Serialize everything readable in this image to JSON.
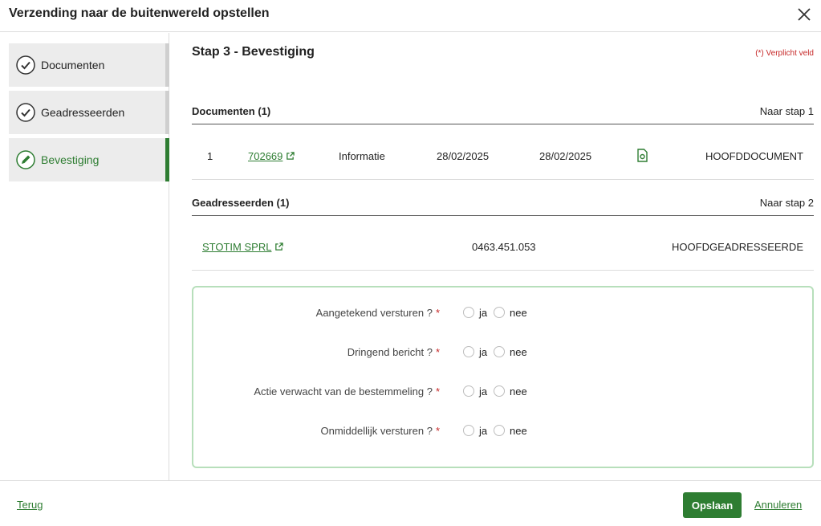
{
  "dialog": {
    "title": "Verzending naar de buitenwereld opstellen",
    "close_icon": "close-icon"
  },
  "sidebar": {
    "steps": [
      {
        "label": "Documenten",
        "state": "done",
        "icon": "check-circle-icon"
      },
      {
        "label": "Geadresseerden",
        "state": "done",
        "icon": "check-circle-icon"
      },
      {
        "label": "Bevestiging",
        "state": "active",
        "icon": "pencil-circle-icon"
      }
    ]
  },
  "main": {
    "step_title": "Stap 3 - Bevestiging",
    "required_note": "(*) Verplicht veld",
    "documents": {
      "title": "Documenten (1)",
      "link": "Naar stap 1",
      "rows": [
        {
          "index": "1",
          "number": "702669",
          "type": "Informatie",
          "date1": "28/02/2025",
          "date2": "28/02/2025",
          "file_icon": "file-icon",
          "role": "HOOFDDOCUMENT"
        }
      ]
    },
    "addressees": {
      "title": "Geadresseerden (1)",
      "link": "Naar stap 2",
      "rows": [
        {
          "name": "STOTIM SPRL",
          "number": "0463.451.053",
          "role": "HOOFDGEADRESSEERDE"
        }
      ]
    },
    "form": {
      "questions": [
        {
          "label": "Aangetekend versturen ?",
          "yes": "ja",
          "no": "nee",
          "required": "*"
        },
        {
          "label": "Dringend bericht ?",
          "yes": "ja",
          "no": "nee",
          "required": "*"
        },
        {
          "label": "Actie verwacht van de bestemmeling ?",
          "yes": "ja",
          "no": "nee",
          "required": "*"
        },
        {
          "label": "Onmiddellijk versturen ?",
          "yes": "ja",
          "no": "nee",
          "required": "*"
        }
      ]
    }
  },
  "footer": {
    "back_label": "Terug",
    "save_label": "Opslaan",
    "cancel_label": "Annuleren"
  },
  "colors": {
    "accent": "#2e7d32",
    "required": "#c62828",
    "form_border": "#b7dfbb"
  }
}
